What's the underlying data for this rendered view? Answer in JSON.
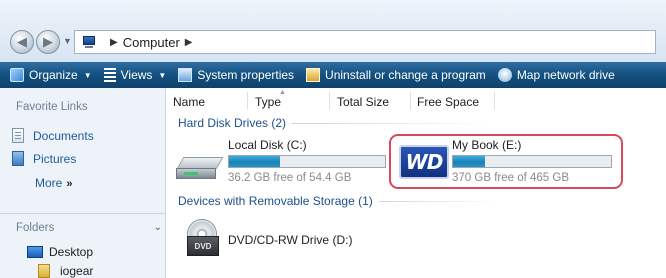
{
  "address_bar": {
    "breadcrumbs": [
      "Computer"
    ]
  },
  "toolbar": {
    "items": [
      {
        "label": "Organize",
        "icon": "organize-icon",
        "has_dropdown": true
      },
      {
        "label": "Views",
        "icon": "views-icon",
        "has_dropdown": true
      },
      {
        "label": "System properties",
        "icon": "system-properties-icon"
      },
      {
        "label": "Uninstall or change a program",
        "icon": "uninstall-icon"
      },
      {
        "label": "Map network drive",
        "icon": "map-network-drive-icon"
      }
    ]
  },
  "sidebar": {
    "favorite_links_heading": "Favorite Links",
    "favorites": [
      {
        "label": "Documents",
        "icon": "documents-icon"
      },
      {
        "label": "Pictures",
        "icon": "pictures-icon"
      }
    ],
    "more_label": "More",
    "more_glyph": "»",
    "folders_heading": "Folders",
    "folders": [
      {
        "label": "Desktop",
        "icon": "desktop-icon"
      },
      {
        "label": "iogear",
        "icon": "folder-icon"
      }
    ]
  },
  "columns": [
    "Name",
    "Type",
    "Total Size",
    "Free Space"
  ],
  "groups": {
    "hard_disk": {
      "heading": "Hard Disk Drives (2)",
      "drives": [
        {
          "name": "Local Disk (C:)",
          "free_text": "36.2 GB free of 54.4 GB",
          "used_fraction": 0.33,
          "icon": "hard-drive-icon"
        },
        {
          "name": "My Book (E:)",
          "free_text": "370 GB free of 465 GB",
          "used_fraction": 0.2,
          "icon": "wd-logo-icon",
          "logo_text": "WD"
        }
      ]
    },
    "removable": {
      "heading": "Devices with Removable Storage (1)",
      "drives": [
        {
          "name": "DVD/CD-RW Drive (D:)",
          "icon": "dvd-drive-icon",
          "badge": "DVD"
        }
      ]
    }
  },
  "colors": {
    "toolbar_bg": "#14507f",
    "link_blue": "#1e5a9e",
    "highlight_red": "#d9485a",
    "usage_bar": "#1c7fb8"
  }
}
